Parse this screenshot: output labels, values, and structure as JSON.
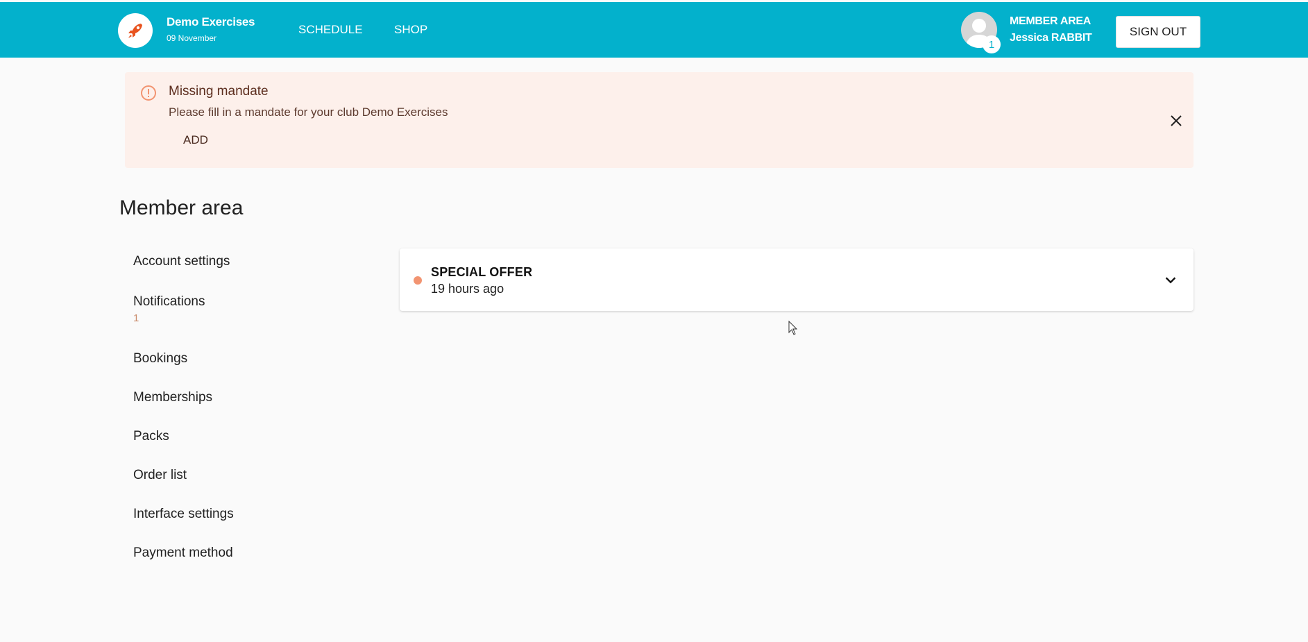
{
  "header": {
    "club_name": "Demo Exercises",
    "date": "09 November",
    "nav": {
      "schedule": "SCHEDULE",
      "shop": "SHOP"
    },
    "member_area_label": "MEMBER AREA",
    "user_name": "Jessica RABBIT",
    "notification_badge": "1",
    "sign_out": "SIGN OUT",
    "brand_color": "#03b1cc"
  },
  "alert": {
    "title": "Missing mandate",
    "text": "Please fill in a mandate for your club Demo Exercises",
    "action": "ADD",
    "icon": "alert-circle-icon",
    "background": "#fdf0eb"
  },
  "page": {
    "title": "Member area"
  },
  "sidebar": {
    "items": [
      {
        "label": "Account settings"
      },
      {
        "label": "Notifications",
        "count": "1"
      },
      {
        "label": "Bookings"
      },
      {
        "label": "Memberships"
      },
      {
        "label": "Packs"
      },
      {
        "label": "Order list"
      },
      {
        "label": "Interface settings"
      },
      {
        "label": "Payment method"
      }
    ]
  },
  "notifications": [
    {
      "title": "SPECIAL OFFER",
      "time": "19 hours ago",
      "unread_color": "#f29471"
    }
  ]
}
